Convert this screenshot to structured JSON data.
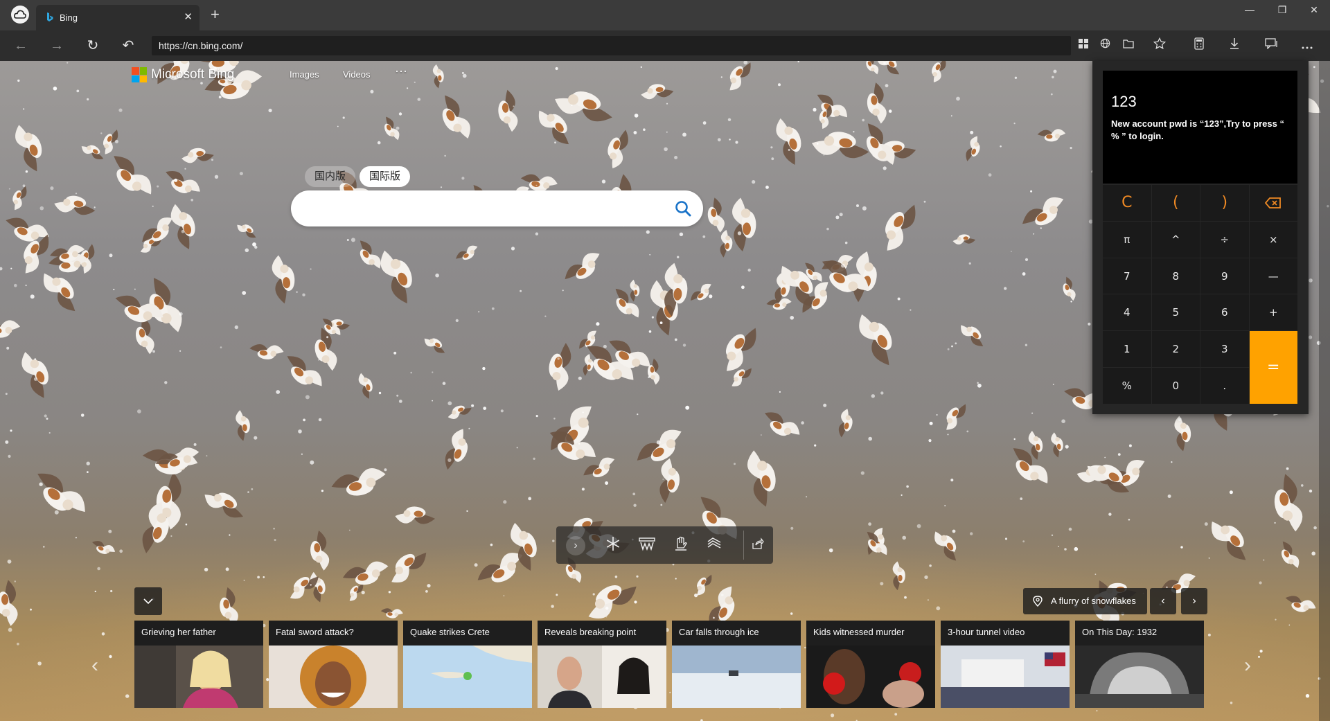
{
  "browser": {
    "tab_title": "Bing",
    "tab_close_glyph": "✕",
    "new_tab_glyph": "+",
    "url": "https://cn.bing.com/",
    "window_controls": {
      "minimize": "—",
      "restore": "❐",
      "close": "✕"
    },
    "nav": {
      "back": "←",
      "forward": "→",
      "refresh": "↻",
      "undo": "↶"
    },
    "address_icons": [
      "apps-icon",
      "translate-icon",
      "collections-icon"
    ],
    "toolbar_icons": [
      "favorite-icon",
      "calculator-icon",
      "download-icon",
      "feedback-icon",
      "more-icon"
    ]
  },
  "bing": {
    "logo_text": "Microsoft Bing",
    "logo_colors": [
      "#f25022",
      "#7fba00",
      "#00a4ef",
      "#ffb900"
    ],
    "nav": {
      "images": "Images",
      "videos": "Videos",
      "more": "···"
    },
    "region": {
      "domestic": "国内版",
      "international": "国际版",
      "selected": "国际版"
    },
    "search": {
      "value": "",
      "placeholder": ""
    },
    "image_info": "A flurry of snowflakes",
    "news": [
      {
        "title": "Grieving her father"
      },
      {
        "title": "Fatal sword attack?"
      },
      {
        "title": "Quake strikes Crete"
      },
      {
        "title": "Reveals breaking point"
      },
      {
        "title": "Car falls through ice"
      },
      {
        "title": "Kids witnessed murder"
      },
      {
        "title": "3-hour tunnel video"
      },
      {
        "title": "On This Day: 1932"
      }
    ]
  },
  "calculator": {
    "display_value": "123",
    "message": "New account pwd is “123”,Try to press “ % ” to login.",
    "keys": [
      [
        "C",
        "(",
        ")",
        "⌫"
      ],
      [
        "π",
        "^",
        "÷",
        "×"
      ],
      [
        "7",
        "8",
        "9",
        "—"
      ],
      [
        "4",
        "5",
        "6",
        "+"
      ],
      [
        "1",
        "2",
        "3"
      ],
      [
        "%",
        "0",
        "."
      ]
    ],
    "equals": "=",
    "accent": "#ffa200"
  }
}
